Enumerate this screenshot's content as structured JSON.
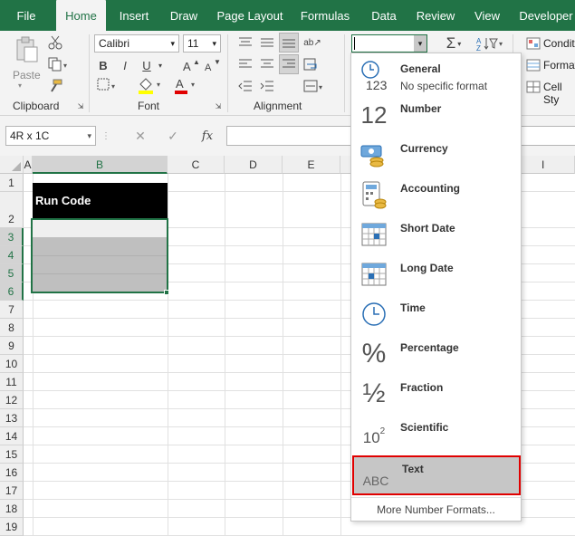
{
  "tabs": [
    "File",
    "Home",
    "Insert",
    "Draw",
    "Page Layout",
    "Formulas",
    "Data",
    "Review",
    "View",
    "Developer"
  ],
  "ribbon": {
    "clipboard": {
      "paste_label": "Paste",
      "group_label": "Clipboard"
    },
    "font": {
      "font_name": "Calibri",
      "font_size": "11",
      "bold": "B",
      "italic": "I",
      "underline": "U",
      "group_label": "Font"
    },
    "alignment": {
      "group_label": "Alignment"
    },
    "number": {
      "format_value": ""
    },
    "styles": {
      "conditional": "Conditi",
      "format": "Format",
      "cell_styles": "Cell Sty"
    }
  },
  "formula_bar": {
    "name_box": "4R x 1C",
    "fx": "fx",
    "formula": ""
  },
  "columns": [
    "A",
    "B",
    "C",
    "D",
    "E",
    "I"
  ],
  "rows": [
    "1",
    "2",
    "3",
    "4",
    "5",
    "6",
    "7",
    "8",
    "9",
    "10",
    "11",
    "12",
    "13",
    "14",
    "15",
    "16",
    "17",
    "18",
    "19"
  ],
  "cells": {
    "b2": "Run Code"
  },
  "number_format_menu": {
    "items": [
      {
        "label": "General",
        "sub": "No specific format",
        "icon": "clock-123-icon"
      },
      {
        "label": "Number",
        "sub": "",
        "icon": "number-12-icon"
      },
      {
        "label": "Currency",
        "sub": "",
        "icon": "currency-icon"
      },
      {
        "label": "Accounting",
        "sub": "",
        "icon": "accounting-icon"
      },
      {
        "label": "Short Date",
        "sub": "",
        "icon": "short-date-icon"
      },
      {
        "label": "Long Date",
        "sub": "",
        "icon": "long-date-icon"
      },
      {
        "label": "Time",
        "sub": "",
        "icon": "clock-icon"
      },
      {
        "label": "Percentage",
        "sub": "",
        "icon": "percent-icon"
      },
      {
        "label": "Fraction",
        "sub": "",
        "icon": "fraction-icon"
      },
      {
        "label": "Scientific",
        "sub": "",
        "icon": "scientific-icon"
      },
      {
        "label": "Text",
        "sub": "",
        "icon": "abc-icon"
      }
    ],
    "icon_text": {
      "general": "123",
      "number": "12",
      "percent": "%",
      "fraction": "½",
      "scientific": "10",
      "sci_exp": "2",
      "abc": "ABC"
    },
    "more_formats": "More Number Formats...",
    "highlight_color": "#e00000",
    "selected": "Text"
  },
  "colors": {
    "accent": "#217346",
    "header_black": "#000000",
    "selection_grey": "#bfbfbf"
  }
}
